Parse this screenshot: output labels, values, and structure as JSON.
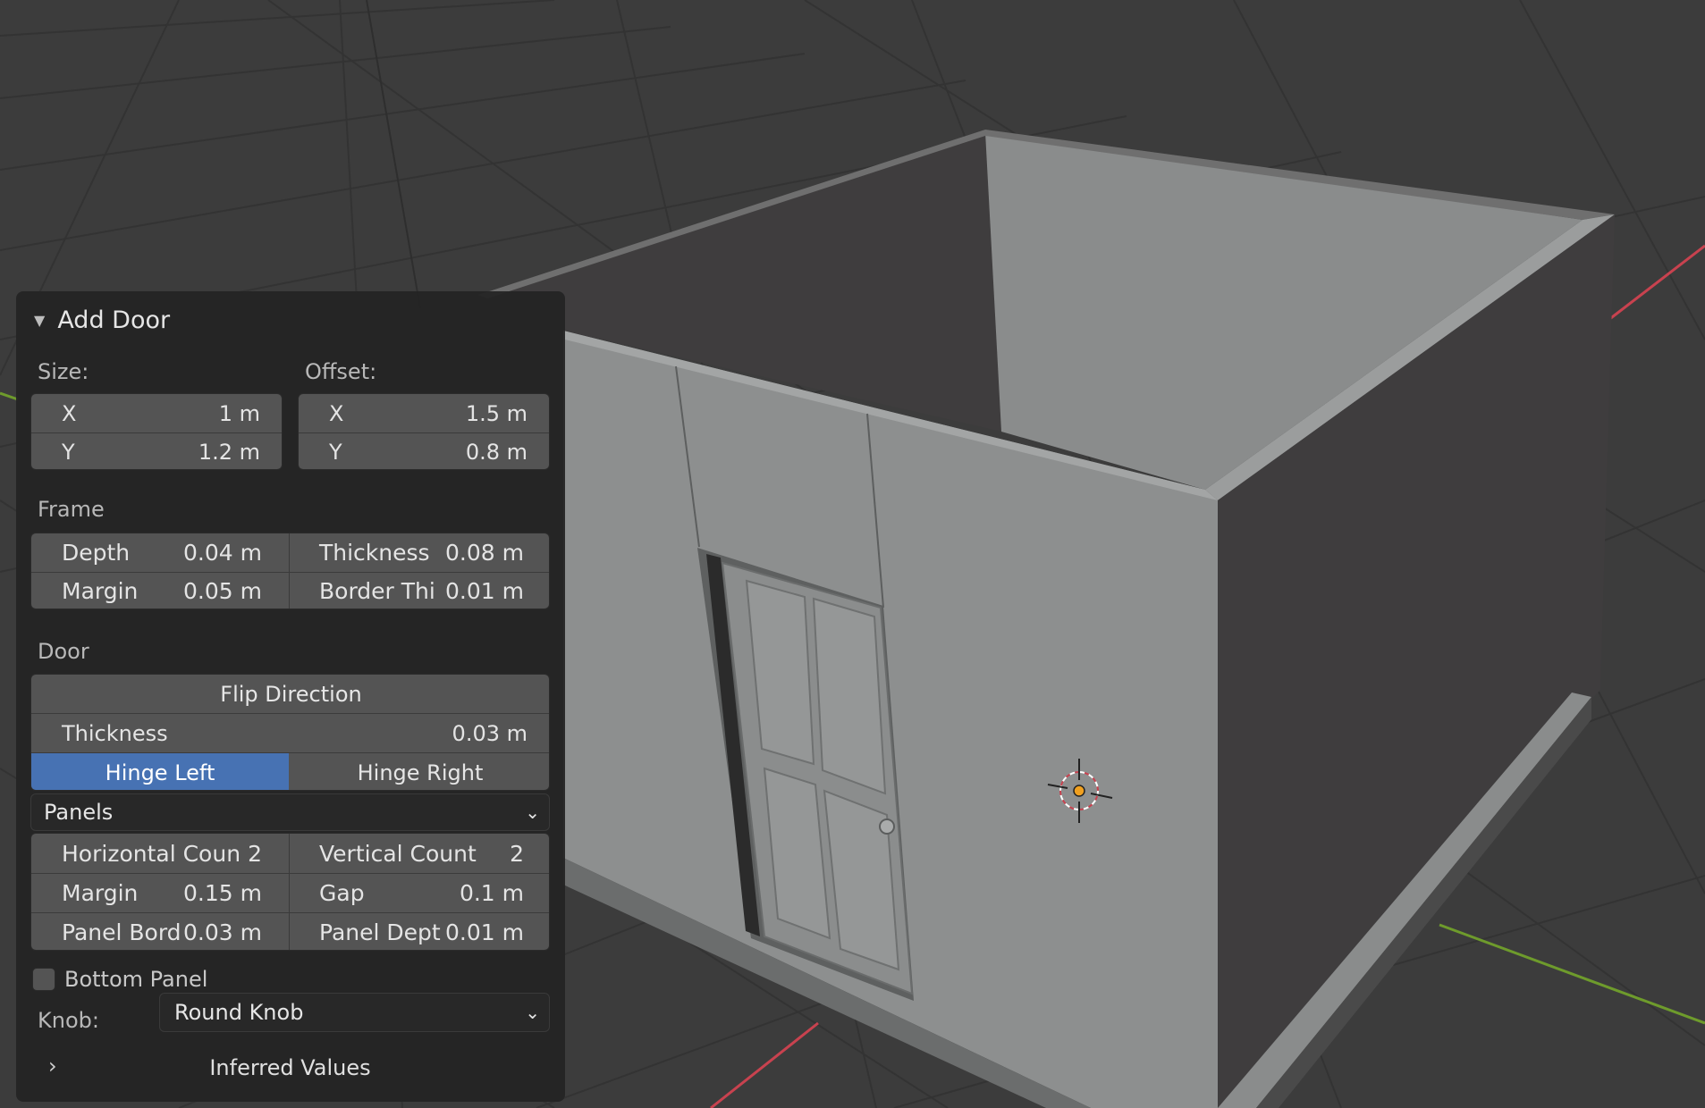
{
  "operator_panel": {
    "title": "Add Door",
    "size": {
      "label": "Size:",
      "x_label": "X",
      "x_value": "1 m",
      "y_label": "Y",
      "y_value": "1.2 m"
    },
    "offset": {
      "label": "Offset:",
      "x_label": "X",
      "x_value": "1.5 m",
      "y_label": "Y",
      "y_value": "0.8 m"
    },
    "frame": {
      "label": "Frame",
      "depth_label": "Depth",
      "depth_value": "0.04 m",
      "thickness_label": "Thickness",
      "thickness_value": "0.08 m",
      "margin_label": "Margin",
      "margin_value": "0.05 m",
      "border_label": "Border Thi",
      "border_value": "0.01 m"
    },
    "door": {
      "label": "Door",
      "flip_direction": "Flip Direction",
      "thickness_label": "Thickness",
      "thickness_value": "0.03 m",
      "hinge_left": "Hinge Left",
      "hinge_right": "Hinge Right",
      "active_hinge": "Hinge Left",
      "door_type": "Panels",
      "horizontal_count_label": "Horizontal Coun",
      "horizontal_count_value": "2",
      "vertical_count_label": "Vertical Count",
      "vertical_count_value": "2",
      "margin_label": "Margin",
      "margin_value": "0.15 m",
      "gap_label": "Gap",
      "gap_value": "0.1 m",
      "panel_border_label": "Panel Bord",
      "panel_border_value": "0.03 m",
      "panel_depth_label": "Panel Dept",
      "panel_depth_value": "0.01 m",
      "bottom_panel_label": "Bottom Panel",
      "bottom_panel_checked": false
    },
    "knob": {
      "label": "Knob:",
      "value": "Round Knob"
    },
    "inferred_values": "Inferred Values"
  },
  "viewport": {
    "background_color": "#3c3c3c",
    "x_axis_color": "#c8424f",
    "y_axis_color": "#6e9b2c",
    "icons": [
      "3d-cursor-icon",
      "door-knob-icon"
    ]
  }
}
